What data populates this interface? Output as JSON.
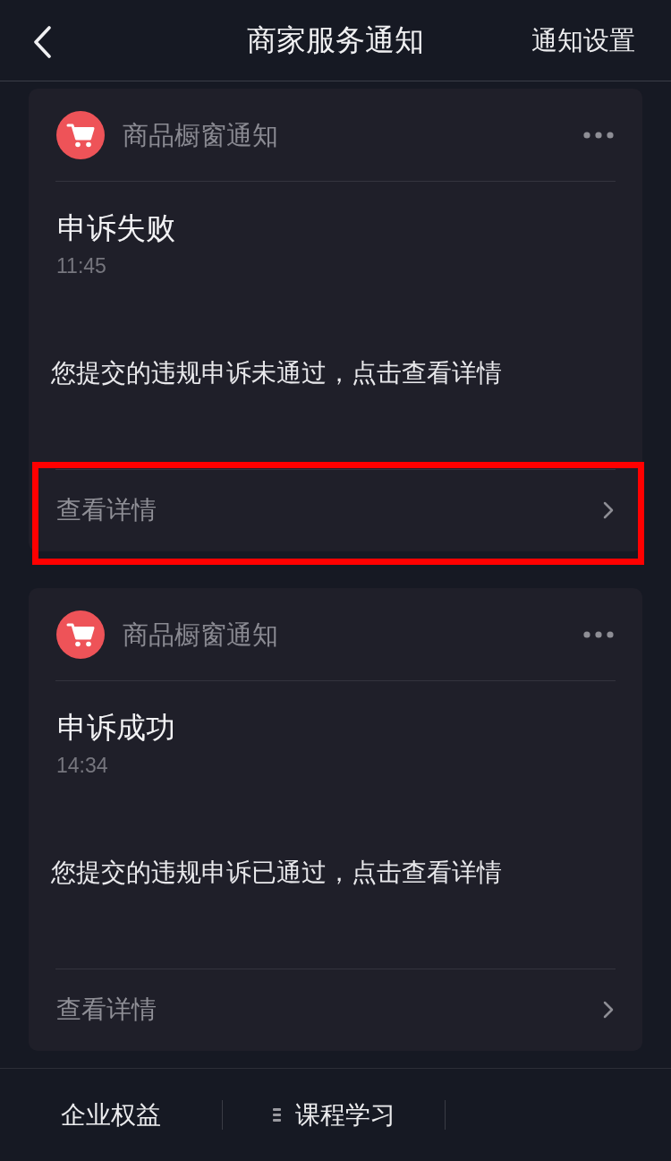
{
  "header": {
    "title": "商家服务通知",
    "action": "通知设置"
  },
  "cards": [
    {
      "source": "商品橱窗通知",
      "title": "申诉失败",
      "time": "11:45",
      "message": "您提交的违规申诉未通过，点击查看详情",
      "link": "查看详情",
      "highlighted": true
    },
    {
      "source": "商品橱窗通知",
      "title": "申诉成功",
      "time": "14:34",
      "message": "您提交的违规申诉已通过，点击查看详情",
      "link": "查看详情",
      "highlighted": false
    }
  ],
  "bottom_bar": {
    "items": [
      {
        "label": "企业权益",
        "kind": "plain"
      },
      {
        "label": "课程学习",
        "kind": "menu"
      }
    ]
  }
}
